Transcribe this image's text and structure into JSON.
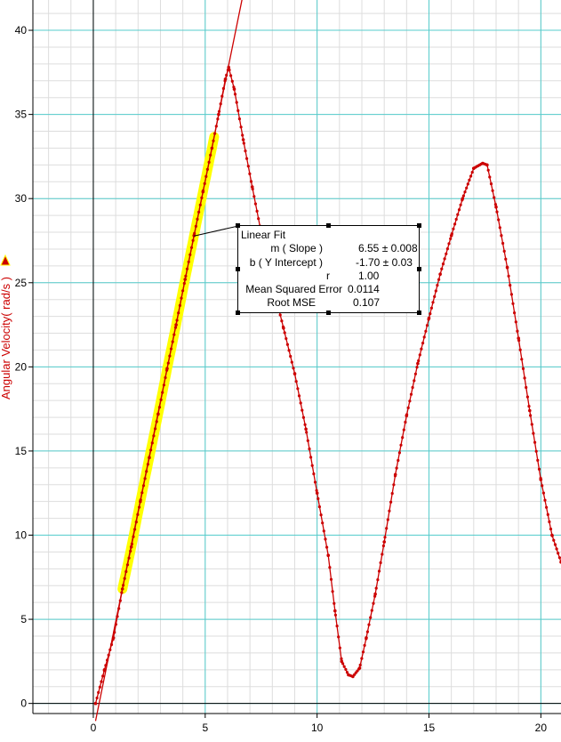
{
  "chart_data": {
    "type": "scatter",
    "title": "",
    "xlabel": "",
    "ylabel": "Angular Velocity( rad/s )",
    "xlim": [
      -2.7,
      20.9
    ],
    "ylim": [
      -0.6,
      41.8
    ],
    "x_ticks": [
      0,
      5,
      10,
      15,
      20
    ],
    "y_ticks": [
      0,
      5,
      10,
      15,
      20,
      25,
      30,
      35,
      40
    ],
    "grid": true,
    "series": [
      {
        "color": "#cc0000",
        "marker": "dot",
        "connected": true,
        "points": [
          [
            0.1,
            0.0
          ],
          [
            0.5,
            2.0
          ],
          [
            0.9,
            3.9
          ],
          [
            1.3,
            6.8
          ],
          [
            1.7,
            9.3
          ],
          [
            2.1,
            12.0
          ],
          [
            2.5,
            14.6
          ],
          [
            2.9,
            17.2
          ],
          [
            3.3,
            19.9
          ],
          [
            3.7,
            22.5
          ],
          [
            4.1,
            25.2
          ],
          [
            4.5,
            27.8
          ],
          [
            4.9,
            30.4
          ],
          [
            5.3,
            33.0
          ],
          [
            5.6,
            35.0
          ],
          [
            5.9,
            37.1
          ],
          [
            6.05,
            37.8
          ],
          [
            6.3,
            36.5
          ],
          [
            6.7,
            33.5
          ],
          [
            7.1,
            30.7
          ],
          [
            7.5,
            28.0
          ],
          [
            8.0,
            25.0
          ],
          [
            8.5,
            22.3
          ],
          [
            9.0,
            19.6
          ],
          [
            9.5,
            16.3
          ],
          [
            10.0,
            12.5
          ],
          [
            10.5,
            8.8
          ],
          [
            10.8,
            5.5
          ],
          [
            11.1,
            2.5
          ],
          [
            11.4,
            1.7
          ],
          [
            11.6,
            1.6
          ],
          [
            11.9,
            2.1
          ],
          [
            12.2,
            3.9
          ],
          [
            12.6,
            6.5
          ],
          [
            13.0,
            9.6
          ],
          [
            13.5,
            13.6
          ],
          [
            14.0,
            17.1
          ],
          [
            14.5,
            20.2
          ],
          [
            15.0,
            22.9
          ],
          [
            15.5,
            25.5
          ],
          [
            16.0,
            27.8
          ],
          [
            16.5,
            30.0
          ],
          [
            17.0,
            31.8
          ],
          [
            17.4,
            32.1
          ],
          [
            17.6,
            32.0
          ],
          [
            18.0,
            29.5
          ],
          [
            18.5,
            25.9
          ],
          [
            19.0,
            21.7
          ],
          [
            19.5,
            17.4
          ],
          [
            20.0,
            13.3
          ],
          [
            20.5,
            10.0
          ],
          [
            20.9,
            8.4
          ]
        ]
      }
    ],
    "selection": {
      "color": "#ffff00",
      "x_range": [
        1.3,
        5.4
      ]
    },
    "fit_line": {
      "slope": 6.55,
      "intercept": -1.7,
      "color": "#cc0000"
    },
    "annotation": {
      "title": "Linear Fit",
      "rows": [
        {
          "label": "m ( Slope )",
          "value": "6.55 ± 0.008"
        },
        {
          "label": "b ( Y Intercept )",
          "value": "-1.70 ± 0.03"
        },
        {
          "label": "r",
          "value": "1.00"
        },
        {
          "label": "Mean Squared Error",
          "value": "0.0114"
        },
        {
          "label": "Root MSE",
          "value": "0.107"
        }
      ]
    },
    "colors": {
      "major_grid": "#55cccc",
      "minor_grid": "#dddddd",
      "axis": "#000000"
    }
  }
}
